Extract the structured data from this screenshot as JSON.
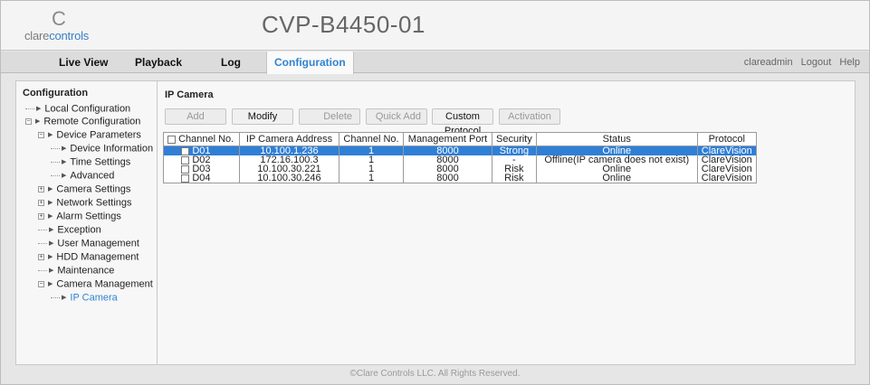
{
  "header": {
    "logo_mark": "C",
    "logo_word_prefix": "clare",
    "logo_word_suffix": "controls",
    "device_title": "CVP-B4450-01"
  },
  "nav": {
    "tabs": [
      {
        "label": "Live View"
      },
      {
        "label": "Playback"
      },
      {
        "label": "Log"
      },
      {
        "label": "Configuration",
        "active": true
      }
    ],
    "user": "clareadmin",
    "logout": "Logout",
    "help": "Help"
  },
  "sidebar": {
    "title": "Configuration",
    "items": [
      {
        "label": "Local Configuration"
      },
      {
        "label": "Remote Configuration"
      },
      {
        "label": "Device Parameters"
      },
      {
        "label": "Device Information"
      },
      {
        "label": "Time Settings"
      },
      {
        "label": "Advanced"
      },
      {
        "label": "Camera Settings"
      },
      {
        "label": "Network Settings"
      },
      {
        "label": "Alarm Settings"
      },
      {
        "label": "Exception"
      },
      {
        "label": "User Management"
      },
      {
        "label": "HDD Management"
      },
      {
        "label": "Maintenance"
      },
      {
        "label": "Camera Management"
      },
      {
        "label": "IP Camera",
        "selected": true
      }
    ]
  },
  "main": {
    "section_title": "IP Camera",
    "toolbar": {
      "add": "Add",
      "modify": "Modify",
      "delete": "Delete",
      "quick_add": "Quick Add",
      "custom_protocol": "Custom Protocol",
      "activation": "Activation"
    },
    "table": {
      "columns": [
        "Channel No.",
        "IP Camera Address",
        "Channel No.",
        "Management Port",
        "Security",
        "Status",
        "Protocol"
      ],
      "rows": [
        {
          "ch": "D01",
          "ip": "10.100.1.236",
          "chno": "1",
          "port": "8000",
          "security": "Strong",
          "status": "Online",
          "protocol": "ClareVision"
        },
        {
          "ch": "D02",
          "ip": "172.16.100.3",
          "chno": "1",
          "port": "8000",
          "security": "-",
          "status": "Offline(IP camera does not exist)",
          "protocol": "ClareVision"
        },
        {
          "ch": "D03",
          "ip": "10.100.30.221",
          "chno": "1",
          "port": "8000",
          "security": "Risk",
          "status": "Online",
          "protocol": "ClareVision"
        },
        {
          "ch": "D04",
          "ip": "10.100.30.246",
          "chno": "1",
          "port": "8000",
          "security": "Risk",
          "status": "Online",
          "protocol": "ClareVision"
        }
      ]
    }
  },
  "footer": {
    "text": "©Clare Controls LLC. All Rights Reserved."
  },
  "colors": {
    "accent": "#2f84d0",
    "selection": "#2f7fd6"
  }
}
